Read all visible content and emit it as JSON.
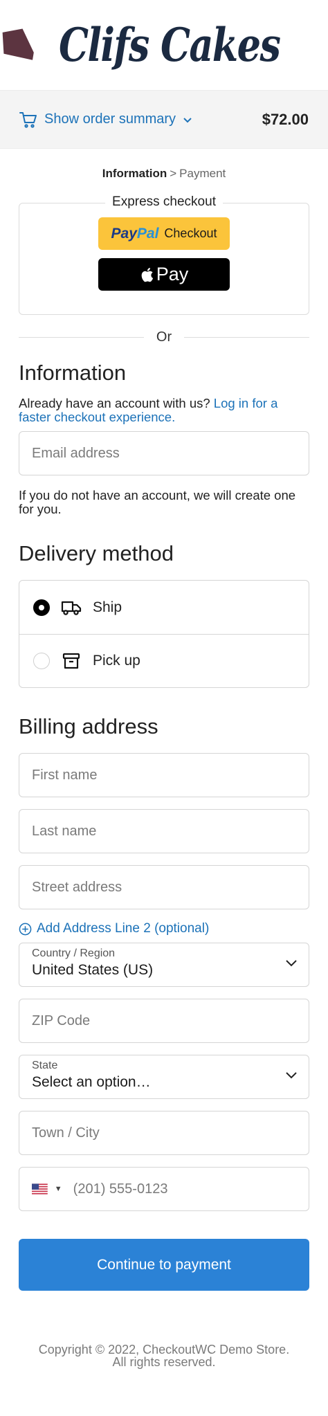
{
  "store": {
    "logo_text": "Clifs Cakes"
  },
  "summary": {
    "toggle_label": "Show order summary",
    "total": "$72.00"
  },
  "breadcrumb": {
    "active": "Information",
    "separator": ">",
    "next": "Payment"
  },
  "express": {
    "legend": "Express checkout",
    "paypal_pay": "Pay",
    "paypal_pal": "Pal",
    "paypal_label": "Checkout",
    "applepay_label": "Pay"
  },
  "divider": {
    "or": "Or"
  },
  "information": {
    "title": "Information",
    "login_prompt": "Already have an account with us?",
    "login_link": "Log in for a faster checkout experience.",
    "email_placeholder": "Email address",
    "account_note": "If you do not have an account, we will create one for you."
  },
  "delivery": {
    "title": "Delivery method",
    "options": [
      {
        "label": "Ship",
        "selected": true
      },
      {
        "label": "Pick up",
        "selected": false
      }
    ]
  },
  "billing": {
    "title": "Billing address",
    "first_name_placeholder": "First name",
    "last_name_placeholder": "Last name",
    "street_placeholder": "Street address",
    "add_line2": "Add Address Line 2 (optional)",
    "country_label": "Country / Region",
    "country_value": "United States (US)",
    "zip_placeholder": "ZIP Code",
    "state_label": "State",
    "state_value": "Select an option…",
    "city_placeholder": "Town / City",
    "phone_placeholder": "(201) 555-0123"
  },
  "actions": {
    "continue_label": "Continue to payment"
  },
  "footer": {
    "line1": "Copyright © 2022, CheckoutWC Demo Store.",
    "line2": "All rights reserved."
  },
  "colors": {
    "accent": "#1c72b8",
    "button": "#2b82d6",
    "paypal_yellow": "#fbc43b",
    "logo_navy": "#1b2a41",
    "logo_mark": "#5c3440"
  }
}
